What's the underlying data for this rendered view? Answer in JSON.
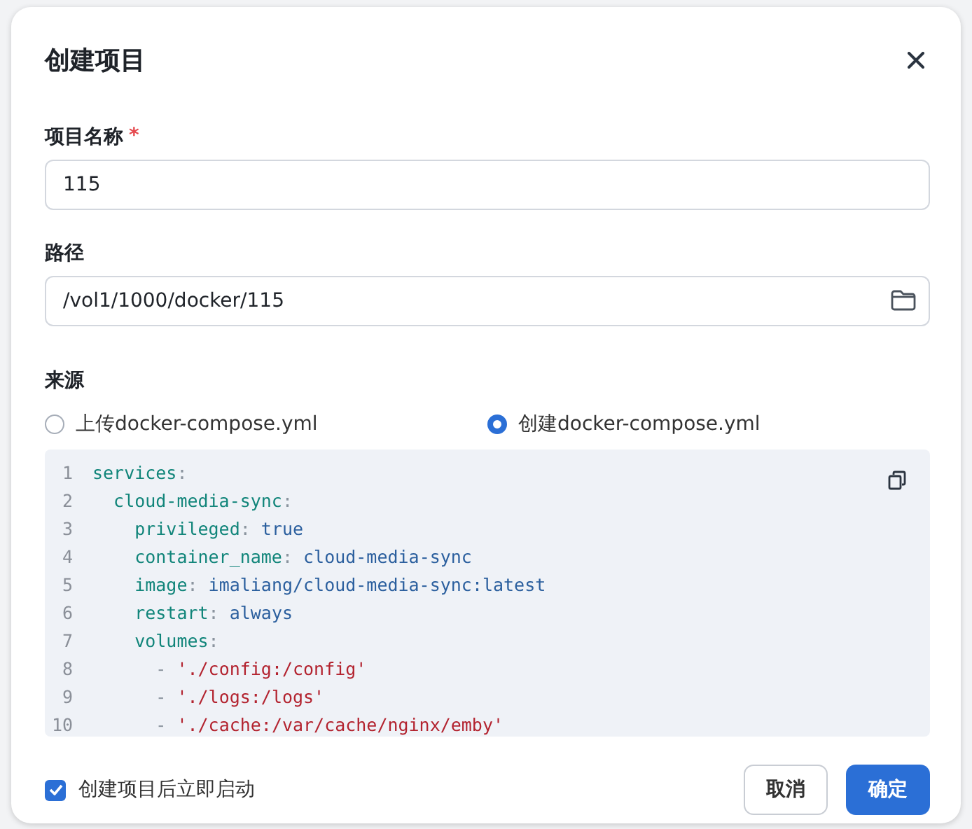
{
  "dialog": {
    "title": "创建项目"
  },
  "fields": [
    {
      "label": "项目名称",
      "required_mark": "*",
      "value": "115",
      "kind": "text"
    },
    {
      "label": "路径",
      "value": "/vol1/1000/docker/115",
      "kind": "folder"
    }
  ],
  "source": {
    "label": "来源",
    "options": [
      {
        "label": "上传docker-compose.yml",
        "selected": false
      },
      {
        "label": "创建docker-compose.yml",
        "selected": true
      }
    ]
  },
  "code": {
    "lines": [
      {
        "number": "1",
        "tokens": [
          {
            "kind": "key",
            "text": "services"
          },
          {
            "kind": "punct",
            "text": ":"
          }
        ]
      },
      {
        "number": "2",
        "tokens": [
          {
            "kind": "key",
            "text": "  cloud-media-sync"
          },
          {
            "kind": "punct",
            "text": ":"
          }
        ]
      },
      {
        "number": "3",
        "tokens": [
          {
            "kind": "key",
            "text": "    privileged"
          },
          {
            "kind": "punct",
            "text": ": "
          },
          {
            "kind": "value",
            "text": "true"
          }
        ]
      },
      {
        "number": "4",
        "tokens": [
          {
            "kind": "key",
            "text": "    container_name"
          },
          {
            "kind": "punct",
            "text": ": "
          },
          {
            "kind": "value",
            "text": "cloud-media-sync"
          }
        ]
      },
      {
        "number": "5",
        "tokens": [
          {
            "kind": "key",
            "text": "    image"
          },
          {
            "kind": "punct",
            "text": ": "
          },
          {
            "kind": "value",
            "text": "imaliang/cloud-media-sync:latest"
          }
        ]
      },
      {
        "number": "6",
        "tokens": [
          {
            "kind": "key",
            "text": "    restart"
          },
          {
            "kind": "punct",
            "text": ": "
          },
          {
            "kind": "value",
            "text": "always"
          }
        ]
      },
      {
        "number": "7",
        "tokens": [
          {
            "kind": "key",
            "text": "    volumes"
          },
          {
            "kind": "punct",
            "text": ":"
          }
        ]
      },
      {
        "number": "8",
        "tokens": [
          {
            "kind": "punct",
            "text": "      - "
          },
          {
            "kind": "string",
            "text": "'./config:/config'"
          }
        ]
      },
      {
        "number": "9",
        "tokens": [
          {
            "kind": "punct",
            "text": "      - "
          },
          {
            "kind": "string",
            "text": "'./logs:/logs'"
          }
        ]
      },
      {
        "number": "10",
        "tokens": [
          {
            "kind": "punct",
            "text": "      - "
          },
          {
            "kind": "string",
            "text": "'./cache:/var/cache/nginx/emby'"
          }
        ]
      }
    ]
  },
  "autostart": {
    "label": "创建项目后立即启动",
    "checked": true
  },
  "buttons": [
    {
      "label": "取消",
      "kind": "secondary"
    },
    {
      "label": "确定",
      "kind": "primary"
    }
  ]
}
